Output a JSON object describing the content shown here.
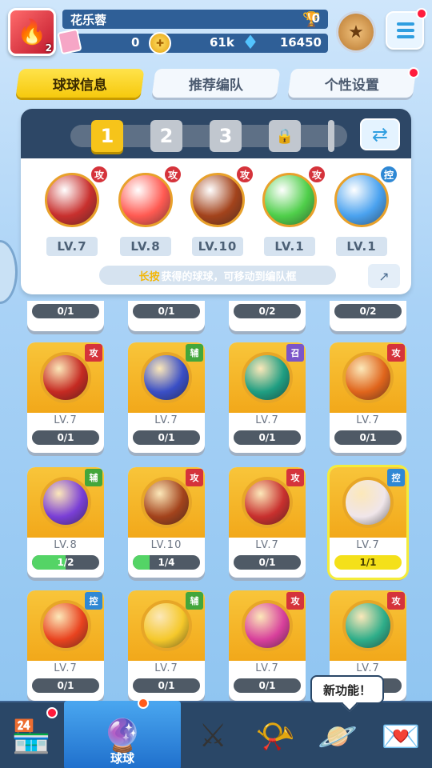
{
  "player": {
    "name": "花乐蓉",
    "avatar_level": "2",
    "trophies": "0",
    "tickets": "0",
    "coins": "61k",
    "gems": "16450"
  },
  "icons": {
    "avatar": "fire-icon",
    "trophy": "trophy-icon",
    "ticket": "ticket-plus-icon",
    "coin": "coin-plus-icon",
    "gem": "gem-plus-icon",
    "rank": "rank-badge-icon",
    "menu": "menu-icon",
    "swap": "swap-icon",
    "share": "share-icon"
  },
  "tabs": [
    {
      "label": "球球信息",
      "active": true
    },
    {
      "label": "推荐编队",
      "active": false
    },
    {
      "label": "个性设置",
      "active": false
    }
  ],
  "team": {
    "slots": [
      "1",
      "2",
      "3"
    ],
    "lock_icon": "🔒",
    "members": [
      {
        "tag": "攻",
        "level": "LV.7",
        "color": "#c8302e"
      },
      {
        "tag": "攻",
        "level": "LV.8",
        "color": "#ff5a52"
      },
      {
        "tag": "攻",
        "level": "LV.10",
        "color": "#a3431c"
      },
      {
        "tag": "攻",
        "level": "LV.1",
        "color": "#4fcf4a"
      },
      {
        "tag": "控",
        "level": "LV.1",
        "color": "#4aa2ef"
      }
    ],
    "hint_highlight": "长按",
    "hint_text": "获得的球球，可移动到编队框"
  },
  "partial_row": [
    "0/1",
    "0/1",
    "0/2",
    "0/2"
  ],
  "cards": [
    {
      "tag": "攻",
      "tag_type": "atk",
      "level": "LV.7",
      "progress_text": "0/1",
      "progress": 0,
      "ball_color": "#c52a22"
    },
    {
      "tag": "辅",
      "tag_type": "sup",
      "level": "LV.7",
      "progress_text": "0/1",
      "progress": 0,
      "ball_color": "#3a4fc6"
    },
    {
      "tag": "召",
      "tag_type": "sum",
      "level": "LV.7",
      "progress_text": "0/1",
      "progress": 0,
      "ball_color": "#1f9e82"
    },
    {
      "tag": "攻",
      "tag_type": "atk",
      "level": "LV.7",
      "progress_text": "0/1",
      "progress": 0,
      "ball_color": "#e0651c"
    },
    {
      "tag": "辅",
      "tag_type": "sup",
      "level": "LV.8",
      "progress_text": "1/2",
      "progress": 0.5,
      "ball_color": "#7a3fd6"
    },
    {
      "tag": "攻",
      "tag_type": "atk",
      "level": "LV.10",
      "progress_text": "1/4",
      "progress": 0.25,
      "ball_color": "#a3431c"
    },
    {
      "tag": "攻",
      "tag_type": "atk",
      "level": "LV.7",
      "progress_text": "0/1",
      "progress": 0,
      "ball_color": "#c8302e"
    },
    {
      "tag": "控",
      "tag_type": "ctl",
      "level": "LV.7",
      "progress_text": "1/1",
      "progress": 1,
      "ball_color": "#f0e6ea",
      "highlight": true
    },
    {
      "tag": "控",
      "tag_type": "ctl",
      "level": "LV.7",
      "progress_text": "0/1",
      "progress": 0,
      "ball_color": "#e9431f"
    },
    {
      "tag": "辅",
      "tag_type": "sup",
      "level": "LV.7",
      "progress_text": "0/1",
      "progress": 0,
      "ball_color": "#f5c82a"
    },
    {
      "tag": "攻",
      "tag_type": "atk",
      "level": "LV.7",
      "progress_text": "0/1",
      "progress": 0,
      "ball_color": "#d8409c"
    },
    {
      "tag": "攻",
      "tag_type": "atk",
      "level": "LV.7",
      "progress_text": "0/1",
      "progress": 0,
      "ball_color": "#2fae8a"
    }
  ],
  "bottom_nav": [
    {
      "name": "shop",
      "icon": "🏪",
      "label": ""
    },
    {
      "name": "balls",
      "icon": "🔮",
      "label": "球球",
      "active": true
    },
    {
      "name": "battle",
      "icon": "⚔",
      "label": ""
    },
    {
      "name": "whistle",
      "icon": "📯",
      "label": ""
    },
    {
      "name": "planet",
      "icon": "🪐",
      "label": ""
    },
    {
      "name": "social",
      "icon": "💌",
      "label": ""
    }
  ],
  "tooltip": "新功能！"
}
